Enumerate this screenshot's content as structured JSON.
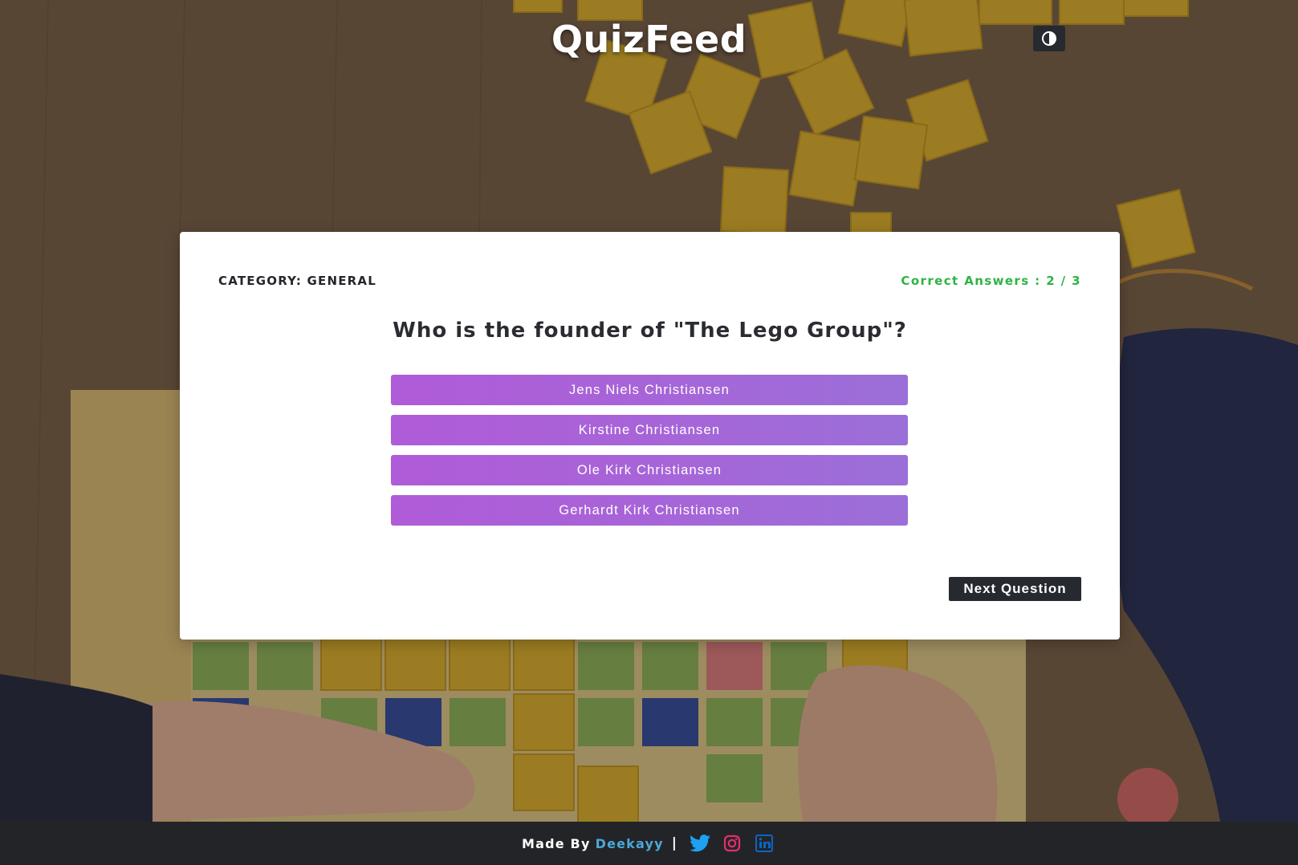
{
  "header": {
    "title": "QuizFeed",
    "theme_toggle_icon": "contrast-icon"
  },
  "quiz": {
    "category_label": "Category: General",
    "score_label": "Correct Answers : 2 / 3",
    "question": "Who is the founder of \"The Lego Group\"?",
    "answers": [
      "Jens Niels Christiansen",
      "Kirstine Christiansen",
      "Ole Kirk Christiansen",
      "Gerhardt Kirk Christiansen"
    ],
    "next_label": "Next Question"
  },
  "footer": {
    "made_by": "Made By",
    "author": "Deekayy",
    "separator": "|",
    "social_icons": [
      "twitter-icon",
      "instagram-icon",
      "linkedin-icon"
    ]
  },
  "colors": {
    "answer_button": "#a866d8",
    "score_text": "#2fb344",
    "author_link": "#4ba9d8",
    "dark_button": "#262a30",
    "footer_bg": "#232427"
  }
}
